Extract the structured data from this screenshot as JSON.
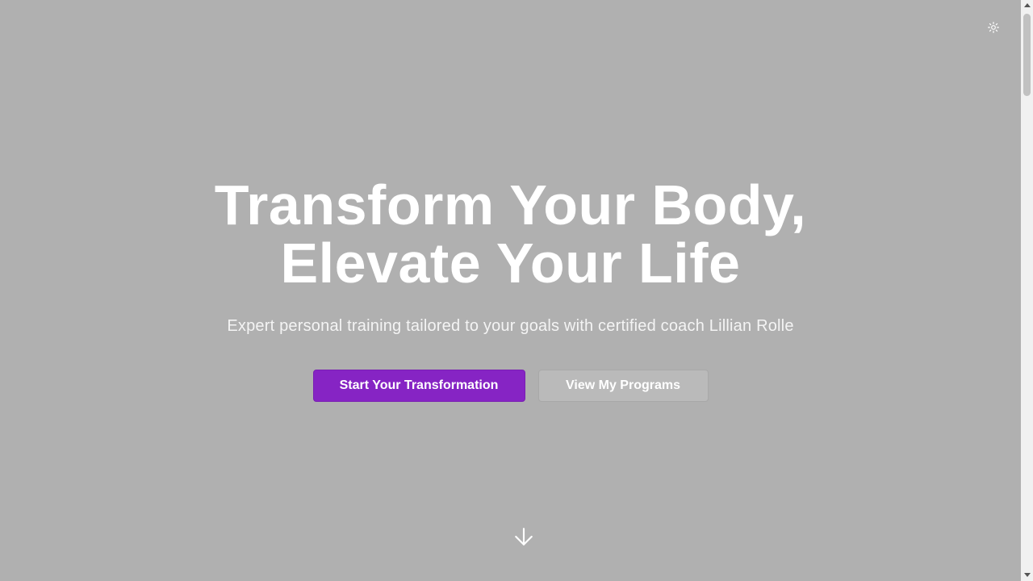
{
  "header": {
    "theme_toggle_icon": "sun-icon"
  },
  "hero": {
    "title_line1": "Transform Your Body,",
    "title_line2": "Elevate Your Life",
    "subtitle": "Expert personal training tailored to your goals with certified coach Lillian Rolle",
    "primary_cta": "Start Your Transformation",
    "secondary_cta": "View My Programs",
    "scroll_icon": "arrow-down-icon"
  },
  "colors": {
    "background": "#b0b0b0",
    "primary_button": "#8624c4",
    "secondary_button": "#bababa",
    "text": "#ffffff"
  }
}
